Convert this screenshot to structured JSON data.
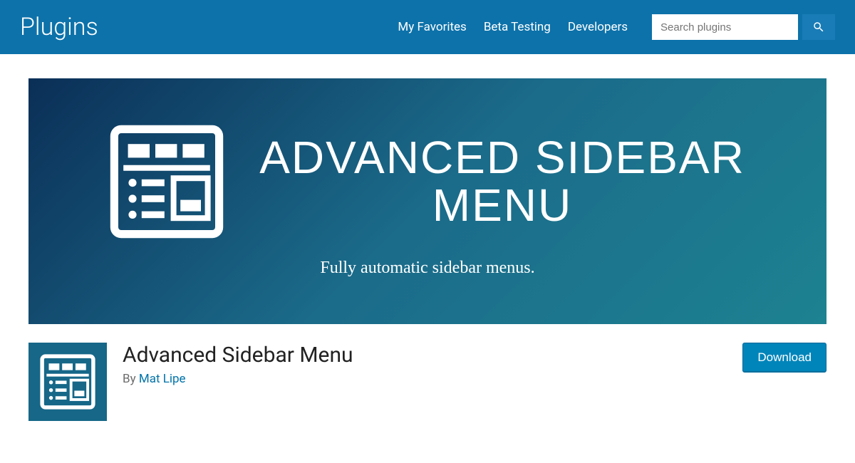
{
  "topbar": {
    "title": "Plugins",
    "links": [
      "My Favorites",
      "Beta Testing",
      "Developers"
    ],
    "search_placeholder": "Search plugins"
  },
  "banner": {
    "title_line1": "ADVANCED SIDEBAR",
    "title_line2": "MENU",
    "subtitle": "Fully automatic sidebar menus."
  },
  "plugin": {
    "name": "Advanced Sidebar Menu",
    "by_prefix": "By ",
    "author": "Mat Lipe",
    "download_label": "Download"
  }
}
